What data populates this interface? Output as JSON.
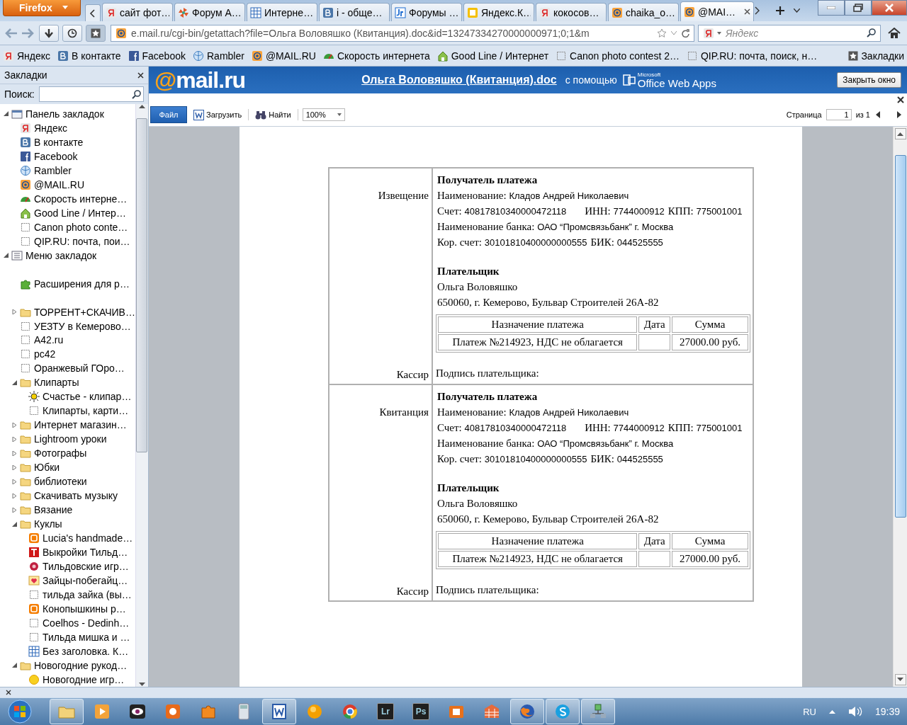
{
  "browser": {
    "menu_button": "Firefox",
    "tabs": [
      {
        "label": "сайт фот…",
        "kind": "y",
        "selected": false
      },
      {
        "label": "Форум А…",
        "kind": "pinwheel",
        "selected": false
      },
      {
        "label": "Интерне…",
        "kind": "grid",
        "selected": false
      },
      {
        "label": "i - обще…",
        "kind": "vk",
        "selected": false
      },
      {
        "label": "Форумы …",
        "kind": "jr",
        "selected": false
      },
      {
        "label": "Яндекс.К…",
        "kind": "square",
        "selected": false
      },
      {
        "label": "кокосов…",
        "kind": "y",
        "selected": false
      },
      {
        "label": "chaika_o…",
        "kind": "at",
        "selected": false
      },
      {
        "label": "@MAI…",
        "kind": "at",
        "selected": true
      }
    ],
    "url": "e.mail.ru/cgi-bin/getattach?file=Ольга Воловяшко (Квитанция).doc&id=13247334270000000971;0;1&m",
    "search": {
      "placeholder": "Яндекс"
    },
    "bookmarks": [
      {
        "label": "Яндекс",
        "kind": "y"
      },
      {
        "label": "В контакте",
        "kind": "vk"
      },
      {
        "label": "Facebook",
        "kind": "fb"
      },
      {
        "label": "Rambler",
        "kind": "globe"
      },
      {
        "label": "@MAIL.RU",
        "kind": "at"
      },
      {
        "label": "Скорость интернета",
        "kind": "gauge"
      },
      {
        "label": "Good Line / Интернет",
        "kind": "house"
      },
      {
        "label": "Canon photo contest 2…",
        "kind": "blank"
      },
      {
        "label": "QIP.RU: почта, поиск, н…",
        "kind": "blank"
      }
    ],
    "bookmarks_menu": "Закладки"
  },
  "sidebar": {
    "title": "Закладки",
    "search_label": "Поиск:",
    "items": [
      {
        "label": "Панель закладок",
        "kind": "toolbar",
        "expanded": true,
        "children": [
          {
            "label": "Яндекс",
            "kind": "y"
          },
          {
            "label": "В контакте",
            "kind": "vk"
          },
          {
            "label": "Facebook",
            "kind": "fb"
          },
          {
            "label": "Rambler",
            "kind": "globe"
          },
          {
            "label": "@MAIL.RU",
            "kind": "at"
          },
          {
            "label": "Скорость интерне…",
            "kind": "gauge"
          },
          {
            "label": "Good Line / Интер…",
            "kind": "house"
          },
          {
            "label": "Canon photo conte…",
            "kind": "blank"
          },
          {
            "label": "QIP.RU: почта, пои…",
            "kind": "blank"
          }
        ]
      },
      {
        "label": "Меню закладок",
        "kind": "menu",
        "expanded": true,
        "children": [
          {
            "kind": "separator"
          },
          {
            "label": "Расширения для р…",
            "kind": "puzzle"
          },
          {
            "kind": "separator"
          },
          {
            "label": "ТОРРЕНТ+СКАЧИВ…",
            "kind": "folder",
            "expanded": false
          },
          {
            "label": "УЕЗТУ в Кемерово…",
            "kind": "blank"
          },
          {
            "label": "A42.ru",
            "kind": "blank"
          },
          {
            "label": "pc42",
            "kind": "blank"
          },
          {
            "label": "Оранжевый ГОро…",
            "kind": "blank"
          },
          {
            "label": "Клипарты",
            "kind": "folder",
            "expanded": true,
            "children": [
              {
                "label": "Счастье - клипар…",
                "kind": "sun"
              },
              {
                "label": "Клипарты, карти…",
                "kind": "blank"
              }
            ]
          },
          {
            "label": "Интернет магазин…",
            "kind": "folder",
            "expanded": false
          },
          {
            "label": "Lightroom уроки",
            "kind": "folder",
            "expanded": false
          },
          {
            "label": "Фотографы",
            "kind": "folder",
            "expanded": false
          },
          {
            "label": "Юбки",
            "kind": "folder",
            "expanded": false
          },
          {
            "label": "библиотеки",
            "kind": "folder",
            "expanded": false
          },
          {
            "label": "Скачивать музыку",
            "kind": "folder",
            "expanded": false
          },
          {
            "label": "Вязание",
            "kind": "folder",
            "expanded": false
          },
          {
            "label": "Куклы",
            "kind": "folder",
            "expanded": true,
            "children": [
              {
                "label": "Lucia's handmade…",
                "kind": "blog"
              },
              {
                "label": "Выкройки Тильд…",
                "kind": "t"
              },
              {
                "label": "Тильдовские игр…",
                "kind": "flower"
              },
              {
                "label": "Зайцы-побегайц…",
                "kind": "heart"
              },
              {
                "label": "тильда зайка (вы…",
                "kind": "blank"
              },
              {
                "label": "Конопышкины р…",
                "kind": "blog"
              },
              {
                "label": "Coelhos - Dedinh…",
                "kind": "blank"
              },
              {
                "label": "Тильда мишка и …",
                "kind": "blank"
              },
              {
                "label": "Без заголовка. К…",
                "kind": "grid"
              }
            ]
          },
          {
            "label": "Новогодние рукод…",
            "kind": "folder",
            "expanded": true,
            "children": [
              {
                "label": "Новогодние игр…",
                "kind": "circle"
              }
            ]
          }
        ]
      }
    ]
  },
  "viewer": {
    "logo": "@mail.ru",
    "document_title": "Ольга Воловяшко (Квитанция).doc",
    "via": "с помощью",
    "office_brand": "Microsoft",
    "office_name": "Office Web Apps",
    "close_button": "Закрыть окно",
    "toolbar": {
      "file_tab": "Файл",
      "upload": "Загрузить",
      "find": "Найти",
      "zoom": "100%",
      "page_label": "Страница",
      "page_value": "1",
      "page_total": "из 1"
    }
  },
  "document": {
    "sections": [
      {
        "label": "Извещение",
        "cashier": "Кассир",
        "recipient_heading": "Получатель платежа",
        "recipient_lines": [
          [
            {
              "label": "Наименование:",
              "value": "Кладов Андрей Николаевич"
            }
          ],
          [
            {
              "label": "Счет:",
              "value": "40817810340000472118"
            },
            {
              "label": "ИНН:",
              "value": "7744000912"
            },
            {
              "label": "КПП:",
              "value": "775001001"
            }
          ],
          [
            {
              "label": "Наименование банка:",
              "value": "ОАО “Промсвязьбанк” г. Москва"
            }
          ],
          [
            {
              "label": "Кор. счет:",
              "value": "30101810400000000555"
            },
            {
              "label": "БИК:",
              "value": "044525555"
            }
          ]
        ],
        "payer_heading": "Плательщик",
        "payer_lines": [
          "Ольга Воловяшко",
          "650060, г. Кемерово, Бульвар Строителей 26А-82"
        ],
        "payment": {
          "columns": [
            "Назначение платежа",
            "Дата",
            "Сумма"
          ],
          "rows": [
            {
              "purpose": "Платеж №214923, НДС не облагается",
              "amount": "27000.00 руб."
            }
          ]
        },
        "signature": "Подпись плательщика:"
      },
      {
        "label": "Квитанция",
        "cashier": "Кассир",
        "recipient_heading": "Получатель платежа",
        "recipient_lines": [
          [
            {
              "label": "Наименование:",
              "value": "Кладов Андрей Николаевич"
            }
          ],
          [
            {
              "label": "Счет:",
              "value": "40817810340000472118"
            },
            {
              "label": "ИНН:",
              "value": "7744000912"
            },
            {
              "label": "КПП:",
              "value": "775001001"
            }
          ],
          [
            {
              "label": "Наименование банка:",
              "value": "ОАО “Промсвязьбанк” г. Москва"
            }
          ],
          [
            {
              "label": "Кор. счет:",
              "value": "30101810400000000555"
            },
            {
              "label": "БИК:",
              "value": "044525555"
            }
          ]
        ],
        "payer_heading": "Плательщик",
        "payer_lines": [
          "Ольга Воловяшко",
          "650060, г. Кемерово, Бульвар Строителей 26А-82"
        ],
        "payment": {
          "columns": [
            "Назначение платежа",
            "Дата",
            "Сумма"
          ],
          "rows": [
            {
              "purpose": "Платеж №214923, НДС не облагается",
              "amount": "27000.00 руб."
            }
          ]
        },
        "signature": "Подпись плательщика:"
      }
    ]
  },
  "taskbar": {
    "apps": [
      {
        "kind": "folder",
        "open": true
      },
      {
        "kind": "media",
        "open": false
      },
      {
        "kind": "eye",
        "open": false
      },
      {
        "kind": "paint",
        "open": false
      },
      {
        "kind": "puzzle",
        "open": false
      },
      {
        "kind": "calc",
        "open": false
      },
      {
        "kind": "word",
        "open": true
      },
      {
        "kind": "orb",
        "open": false
      },
      {
        "kind": "chrome",
        "open": false
      },
      {
        "kind": "badge",
        "label": "Lr",
        "open": false
      },
      {
        "kind": "badge",
        "label": "Ps",
        "open": false
      },
      {
        "kind": "box",
        "open": false
      },
      {
        "kind": "grid",
        "open": false
      },
      {
        "kind": "firefox",
        "open": true
      },
      {
        "kind": "skype",
        "open": true
      },
      {
        "kind": "network",
        "open": true
      }
    ],
    "language": "RU",
    "time": "19:39"
  }
}
